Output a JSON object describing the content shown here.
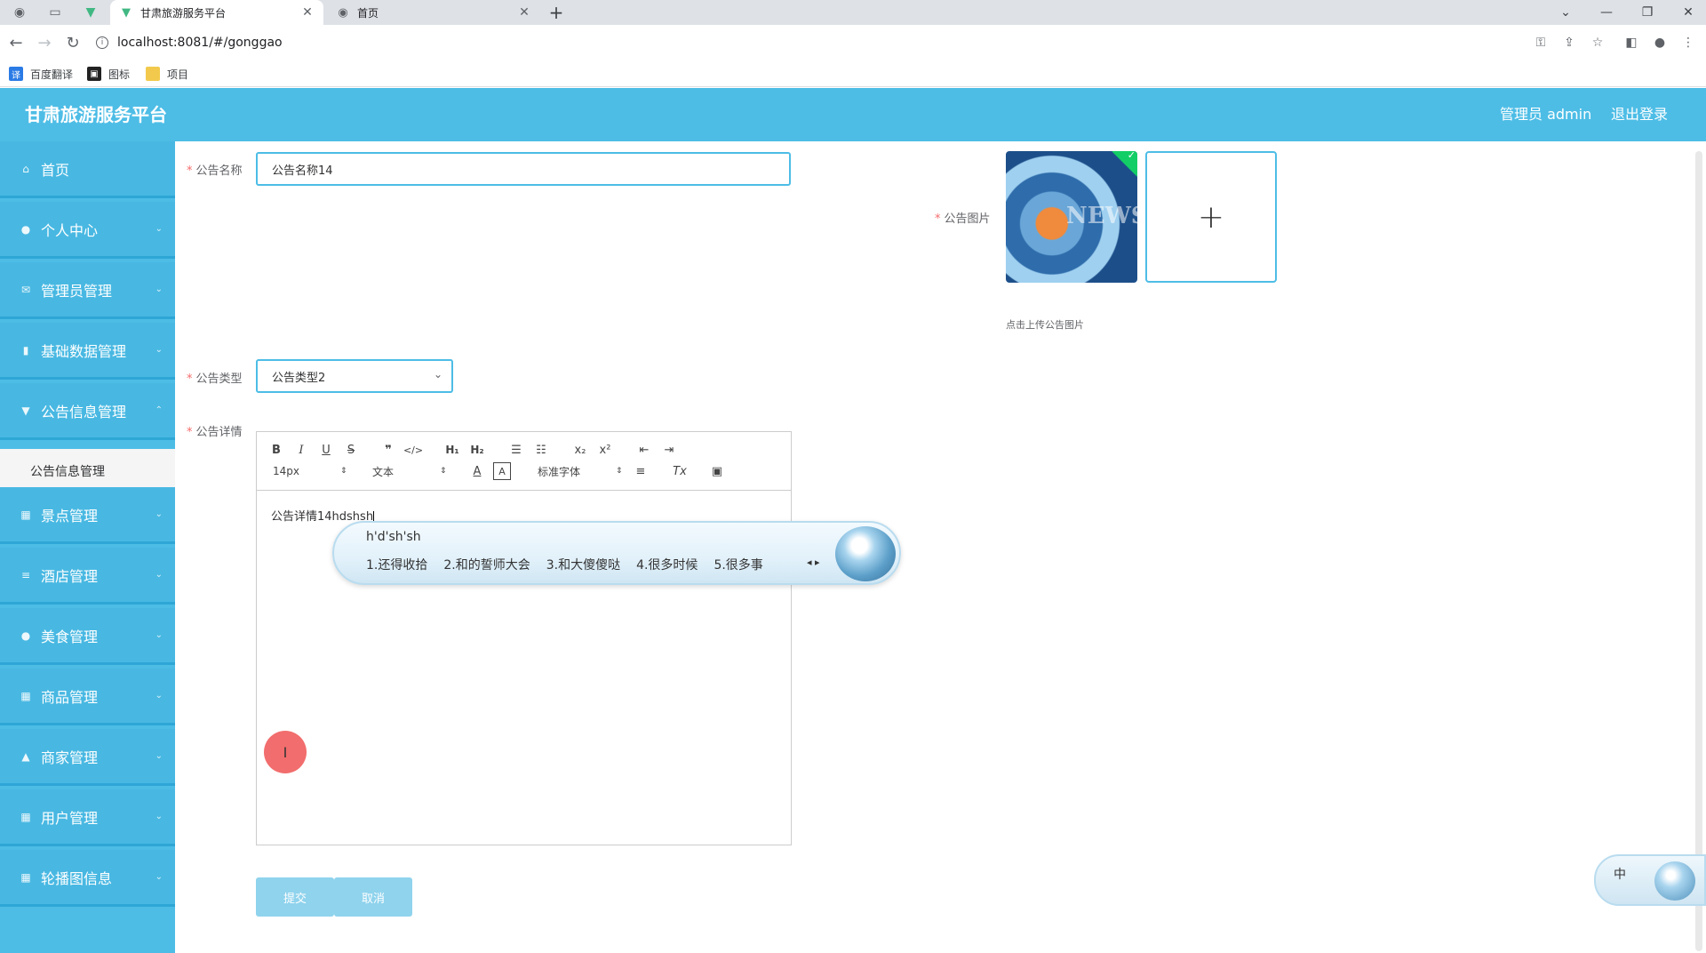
{
  "browser": {
    "tabs": [
      {
        "title": "甘肃旅游服务平台",
        "active": true
      },
      {
        "title": "首页",
        "active": false
      }
    ],
    "url": "localhost:8081/#/gonggao",
    "bookmarks": [
      "百度翻译",
      "图标",
      "项目"
    ]
  },
  "header": {
    "brand": "甘肃旅游服务平台",
    "user": "管理员 admin",
    "logout": "退出登录"
  },
  "sidebar": {
    "items": [
      {
        "label": "首页",
        "icon": "home-icon"
      },
      {
        "label": "个人中心",
        "icon": "user-icon"
      },
      {
        "label": "管理员管理",
        "icon": "admin-icon"
      },
      {
        "label": "基础数据管理",
        "icon": "data-icon"
      },
      {
        "label": "公告信息管理",
        "icon": "notice-icon"
      },
      {
        "label": "景点管理",
        "icon": "grid-icon"
      },
      {
        "label": "酒店管理",
        "icon": "list-icon"
      },
      {
        "label": "美食管理",
        "icon": "location-icon"
      },
      {
        "label": "商品管理",
        "icon": "grid-icon"
      },
      {
        "label": "商家管理",
        "icon": "shop-icon"
      },
      {
        "label": "用户管理",
        "icon": "grid-icon"
      },
      {
        "label": "轮播图信息",
        "icon": "grid-icon"
      }
    ],
    "active_sub": "公告信息管理"
  },
  "form": {
    "name_label": "公告名称",
    "name_value": "公告名称14",
    "image_label": "公告图片",
    "image_thumb_text": "NEWS",
    "upload_tip": "点击上传公告图片",
    "type_label": "公告类型",
    "type_value": "公告类型2",
    "detail_label": "公告详情",
    "editor": {
      "font_size": "14px",
      "block_format": "文本",
      "font_family": "标准字体",
      "content": "公告详情14hdshsh"
    },
    "submit": "提交",
    "cancel": "取消"
  },
  "ime": {
    "composition": "h'd'sh'sh",
    "candidates": [
      "1.还得收拾",
      "2.和的誓师大会",
      "3.和大傻傻哒",
      "4.很多时候",
      "5.很多事"
    ],
    "status": "中"
  },
  "colors": {
    "primary": "#4dbde6",
    "sidebar_border": "#2ea6d6",
    "required": "#f56c6c",
    "button": "#8fd3ed"
  }
}
